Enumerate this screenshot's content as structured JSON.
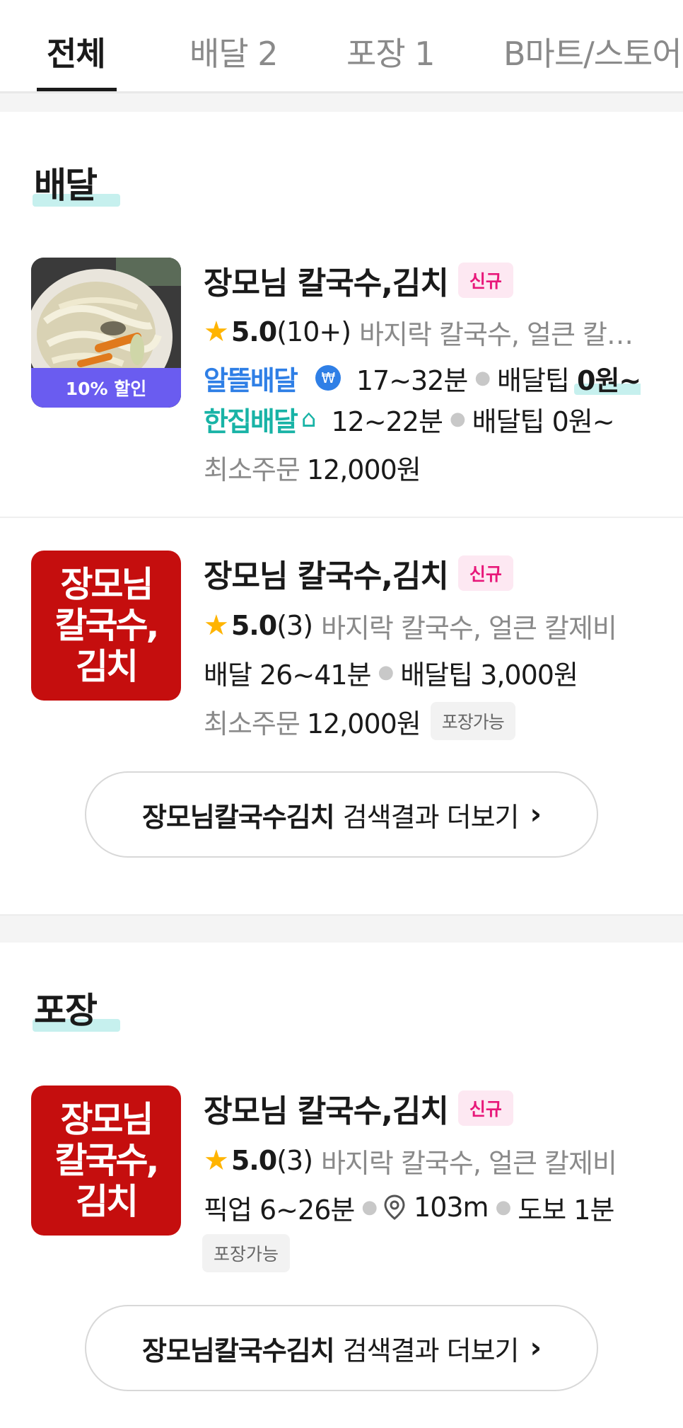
{
  "tabs": [
    {
      "label": "전체",
      "active": true
    },
    {
      "label": "배달 2",
      "active": false
    },
    {
      "label": "포장 1",
      "active": false
    },
    {
      "label": "B마트/스토어",
      "active": false
    }
  ],
  "delivery_section": {
    "title": "배달",
    "stores": [
      {
        "name": "장모님 칼국수,김치",
        "badge": "신규",
        "discount_label": "10% 할인",
        "rating": "5.0",
        "review_count": "(10+)",
        "menu": "바지락 칼국수, 얼큰 칼제비",
        "options": [
          {
            "brand": "알뜰배달",
            "time": "17~32분",
            "tip_label": "배달팁",
            "tip_value": "0원~"
          },
          {
            "brand": "한집배달",
            "time": "12~22분",
            "tip_label": "배달팁",
            "tip_value": "0원~"
          }
        ],
        "min_order_label": "최소주문",
        "min_order_value": "12,000원"
      },
      {
        "name": "장모님 칼국수,김치",
        "badge": "신규",
        "logo_text": "장모님\n칼국수,\n김치",
        "rating": "5.0",
        "review_count": "(3)",
        "menu": "바지락 칼국수, 얼큰 칼제비",
        "delivery_time": "배달 26~41분",
        "tip": "배달팁 3,000원",
        "min_order_label": "최소주문",
        "min_order_value": "12,000원",
        "takeout_chip": "포장가능"
      }
    ],
    "more_button": {
      "keyword": "장모님칼국수김치",
      "rest": "검색결과 더보기"
    }
  },
  "takeout_section": {
    "title": "포장",
    "stores": [
      {
        "name": "장모님 칼국수,김치",
        "badge": "신규",
        "logo_text": "장모님\n칼국수,\n김치",
        "rating": "5.0",
        "review_count": "(3)",
        "menu": "바지락 칼국수, 얼큰 칼제비",
        "pickup_time": "픽업 6~26분",
        "distance": "103m",
        "walk_time": "도보 1분",
        "takeout_chip": "포장가능"
      }
    ],
    "more_button": {
      "keyword": "장모님칼국수김치",
      "rest": "검색결과 더보기"
    }
  },
  "icons": {
    "star": "star-icon",
    "coin": "won-coin-icon",
    "house": "house-speed-icon",
    "pin": "location-pin-icon",
    "chevron": "chevron-right-icon"
  },
  "colors": {
    "badge_new": "#e8187a",
    "discount_band": "#6a5cf0",
    "logo_red": "#c50e0e",
    "alttul_blue": "#2f7fe6",
    "hanjip_teal": "#18b3a6",
    "star": "#ffb400"
  }
}
